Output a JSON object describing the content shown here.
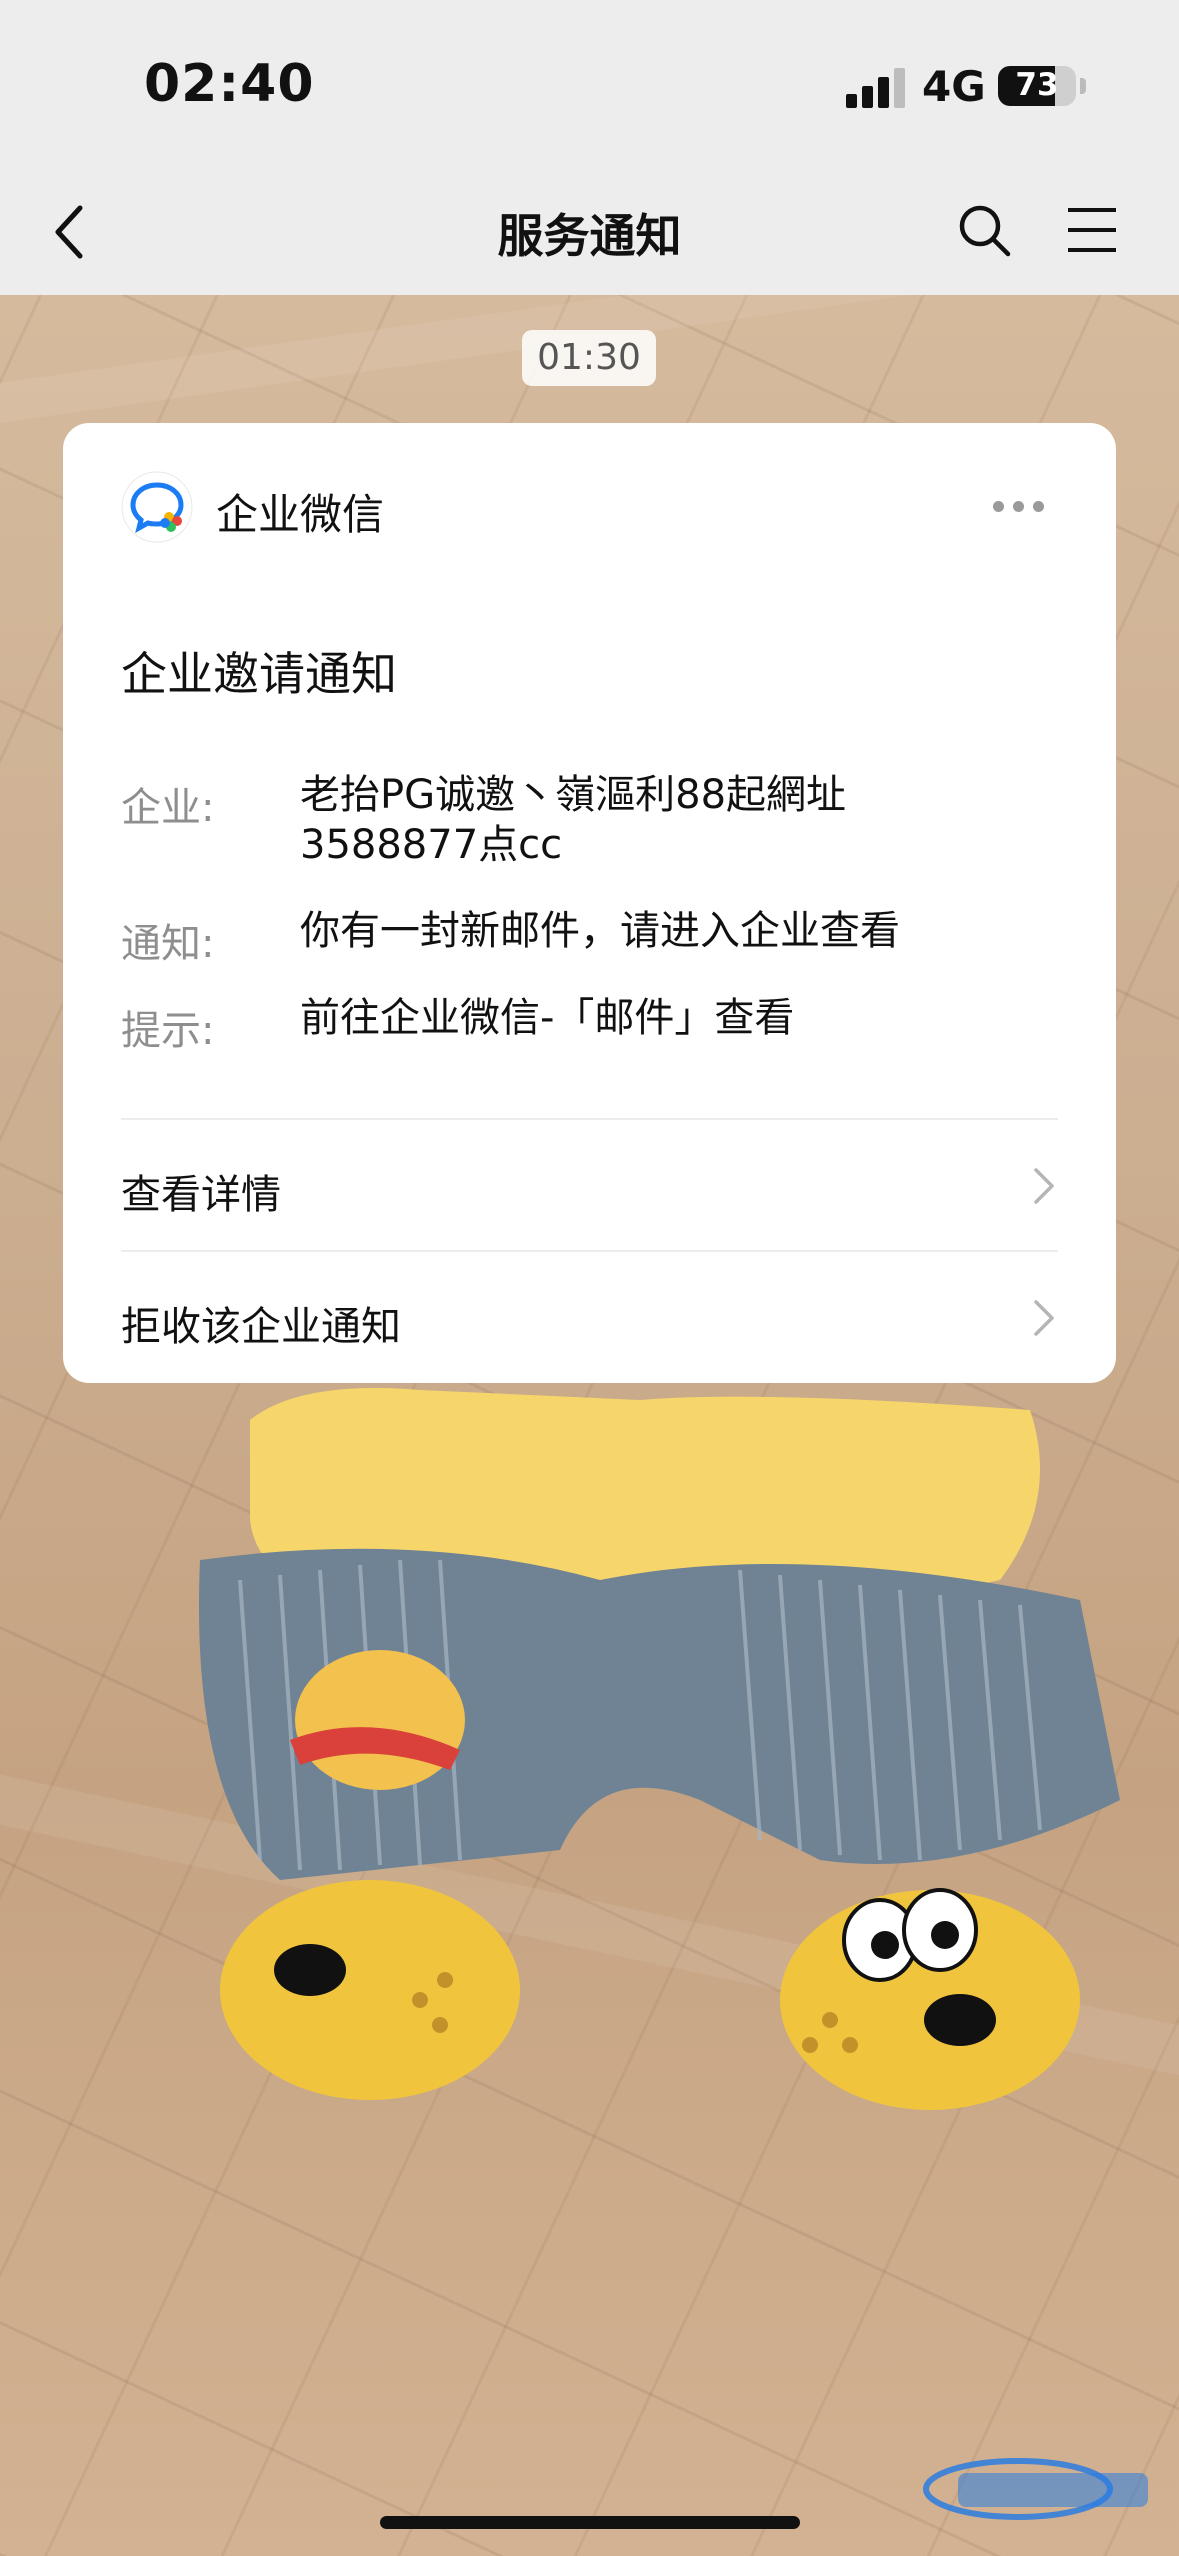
{
  "status_bar": {
    "time": "02:40",
    "network": "4G",
    "battery_level": "73",
    "battery_fraction": 0.73,
    "signal_bars_active": 3,
    "signal_bars_total": 4
  },
  "nav": {
    "title": "服务通知",
    "back_icon": "chevron-left-icon",
    "search_icon": "search-icon",
    "menu_icon": "hamburger-menu-icon"
  },
  "message_time": "01:30",
  "card": {
    "app_name": "企业微信",
    "app_icon": "wecom-logo-icon",
    "title": "企业邀请通知",
    "rows": [
      {
        "label": "企业:",
        "value_line1": "老抬PG诚邀丶嶺漚利88起網址",
        "value_line2": " 3588877点cc"
      },
      {
        "label": "通知:",
        "value": "你有一封新邮件，请进入企业查看"
      },
      {
        "label": "提示:",
        "value": "前往企业微信-「邮件」查看"
      }
    ],
    "actions": [
      {
        "label": "查看详情"
      },
      {
        "label": "拒收该企业通知"
      }
    ]
  },
  "colors": {
    "bar_bg": "#ededed",
    "card_bg": "#ffffff",
    "label_gray": "#8e8e8e",
    "text_dark": "#111111",
    "wecom_blue": "#1c7cf4"
  }
}
